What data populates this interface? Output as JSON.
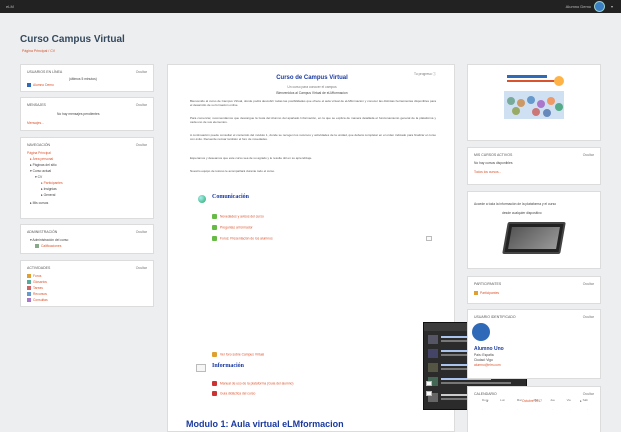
{
  "topbar": {
    "brand": "eLM",
    "user": "Alumno Demo"
  },
  "course": {
    "title": "Curso Campus Virtual",
    "breadcrumb": "Página Principal  /  CV"
  },
  "left": {
    "b1": {
      "header": "USUARIOS EN LÍNEA",
      "hide": "Ocultar",
      "line1": "(últimos 5 minutos)",
      "user": "Alumno Demo"
    },
    "b2": {
      "header": "MENSAJES",
      "hide": "Ocultar",
      "line1": "No hay mensajes pendientes",
      "link": "Mensajes..."
    },
    "b3": {
      "header": "NAVEGACIÓN",
      "hide": "Ocultar",
      "items": [
        "Página Principal",
        "Área personal",
        "Páginas del sitio",
        "Curso actual",
        "CV",
        "Participantes",
        "Insignias",
        "General",
        "Mis cursos"
      ]
    },
    "b4": {
      "header": "ADMINISTRACIÓN",
      "hide": "Ocultar",
      "items": [
        "Administración del curso",
        "Calificaciones"
      ]
    },
    "b5": {
      "header": "ACTIVIDADES",
      "hide": "Ocultar",
      "items": [
        "Foros",
        "Glosarios",
        "Tareas",
        "Recursos",
        "Consultas"
      ]
    }
  },
  "main": {
    "progress": "Tu progreso",
    "title": "Curso de Campus Virtual",
    "subtitle": "Un curso para conocer el campus",
    "welcome": "Bienvenidos al Campus Virtual de eLMformacion",
    "paragraphs": [
      "Bienvenido al curso de Campus Virtual, donde podrá descubrir todas las posibilidades que ofrece el aula virtual de eLMformacion y conocer las distintas herramientas disponibles para el desarrollo de su formación online.",
      "Para comenzar, recomendamos que descargue la Guía del Alumno del apartado Información, en la que se explica de manera detallada el funcionamiento general de la plataforma y cada uno de sus elementos.",
      "A continuación puede consultar el contenido del módulo 1, donde se recogen los recursos y actividades de la unidad, que deberá completar en el orden indicado para finalizar el curso con éxito. Recuerde revisar también el foro de novedades.",
      "Esperamos y deseamos que este curso sea de su agrado y le resulte útil en su aprendizaje."
    ],
    "closing": "Nuestro equipo de tutores le acompañará durante todo el curso.",
    "sec_comm": "Comunicación",
    "comm_items": [
      "Novedades y avisos del curso",
      "Preguntas al formador",
      "Foros: Presentación de los alumnos"
    ],
    "comm_footer": "Ver foro sobre Campus Virtual",
    "sec_info": "Información",
    "info_items": [
      "Manual de uso de la plataforma (Guía del alumno)",
      "Guía didáctica del curso"
    ],
    "module": "Modulo 1: Aula virtual eLMformacion"
  },
  "right": {
    "b2": {
      "header": "MIS CURSOS ACTIVOS",
      "hide": "Ocultar",
      "line1": "No hay cursos disponibles",
      "link": "Todos los cursos..."
    },
    "b3": {
      "text1": "Accede a toda la información de la plataforma y el curso",
      "text2": "desde cualquier dispositivo"
    },
    "b4": {
      "header": "PARTICIPANTES",
      "hide": "Ocultar",
      "link": "Participantes"
    },
    "b5": {
      "header": "USUARIO IDENTIFICADO",
      "hide": "Ocultar",
      "name": "Alumno Uno",
      "country": "País: España",
      "city": "Ciudad: Vigo",
      "email": "alumno@elm.com"
    },
    "b6": {
      "header": "CALENDARIO",
      "hide": "Ocultar",
      "month": "Octubre 2017",
      "days": [
        "Dom",
        "Lun",
        "Mar",
        "Mié",
        "Jue",
        "Vie",
        "Sáb"
      ]
    }
  },
  "colors": {
    "accent": "#d9532c",
    "title_blue": "#1a3aa0",
    "topbar": "#222222"
  }
}
